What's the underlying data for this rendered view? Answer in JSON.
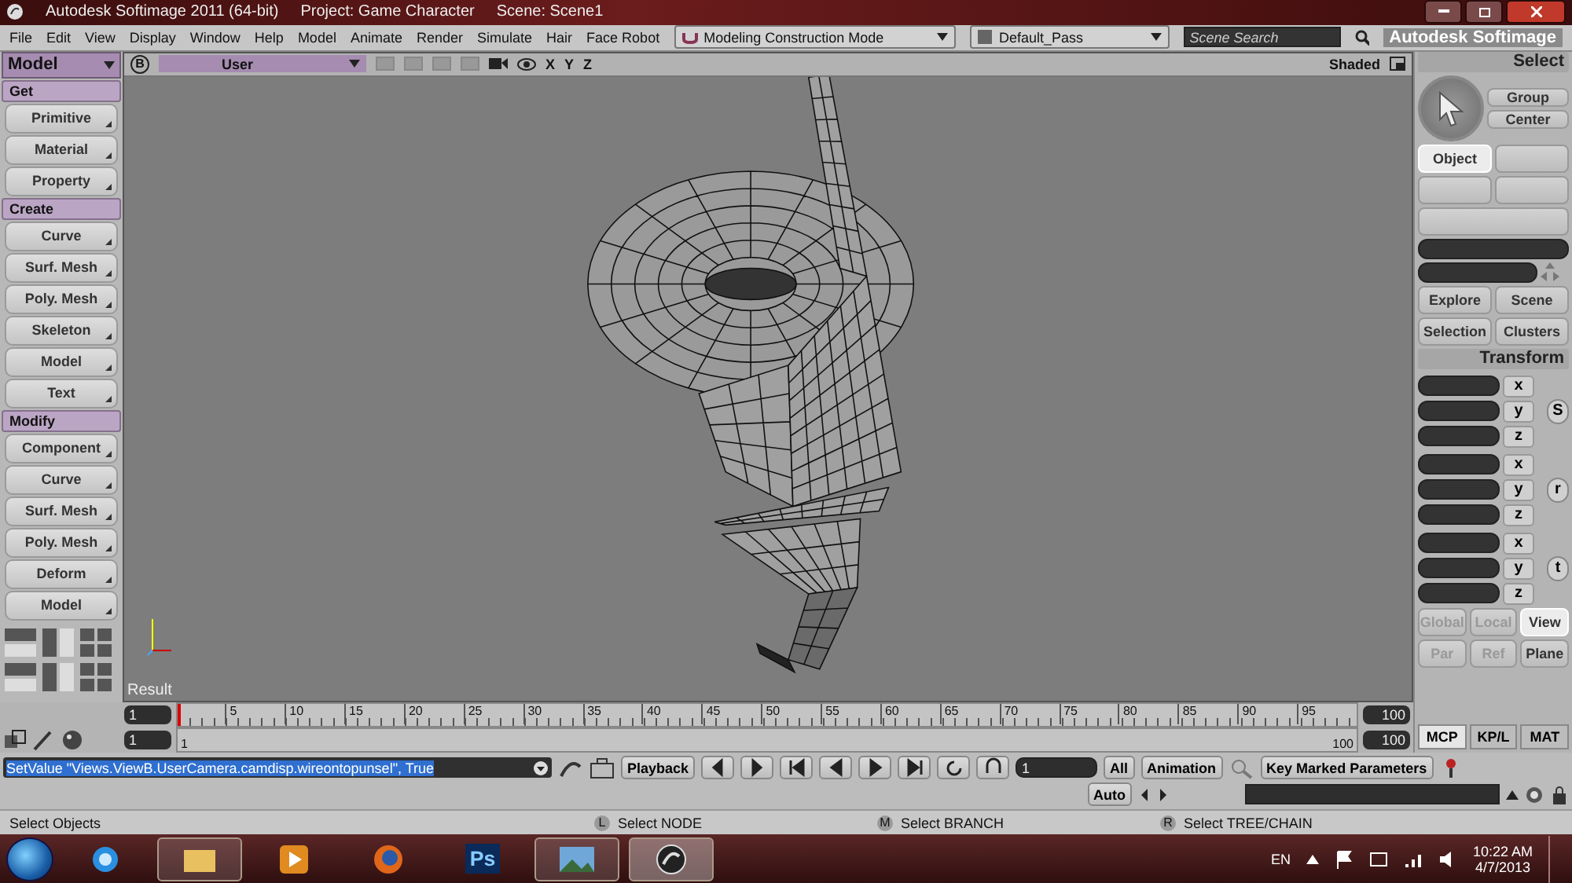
{
  "window": {
    "title": "Autodesk Softimage 2011 (64-bit)",
    "project": "Project: Game Character",
    "scene": "Scene: Scene1"
  },
  "menu": [
    "File",
    "Edit",
    "View",
    "Display",
    "Window",
    "Help",
    "Model",
    "Animate",
    "Render",
    "Simulate",
    "Hair",
    "Face Robot"
  ],
  "toolbar": {
    "mode": "Modeling Construction Mode",
    "pass": "Default_Pass",
    "search": {
      "placeholder": "Scene Search"
    },
    "brand": "Autodesk Softimage"
  },
  "left_panel": {
    "title": "Model",
    "sections": [
      {
        "title": "Get",
        "buttons": [
          "Primitive",
          "Material",
          "Property"
        ]
      },
      {
        "title": "Create",
        "buttons": [
          "Curve",
          "Surf. Mesh",
          "Poly. Mesh",
          "Skeleton",
          "Model",
          "Text"
        ]
      },
      {
        "title": "Modify",
        "buttons": [
          "Component",
          "Curve",
          "Surf. Mesh",
          "Poly. Mesh",
          "Deform",
          "Model"
        ]
      }
    ]
  },
  "viewport": {
    "letter": "B",
    "camera": "User",
    "axes": [
      "X",
      "Y",
      "Z"
    ],
    "shading": "Shaded",
    "label": "Result"
  },
  "right_panel": {
    "select": {
      "title": "Select",
      "buttons": [
        "Group",
        "Center"
      ],
      "object": {
        "label": "Object",
        "selected": true
      },
      "nav": [
        "Explore",
        "Scene",
        "Selection",
        "Clusters"
      ]
    },
    "transform": {
      "title": "Transform",
      "groups": [
        {
          "key": "S",
          "axes": [
            "x",
            "y",
            "z"
          ]
        },
        {
          "key": "r",
          "axes": [
            "x",
            "y",
            "z"
          ]
        },
        {
          "key": "t",
          "axes": [
            "x",
            "y",
            "z"
          ]
        }
      ],
      "spaces": [
        {
          "label": "Global",
          "selected": false,
          "disabled": true
        },
        {
          "label": "Local",
          "selected": false,
          "disabled": true
        },
        {
          "label": "View",
          "selected": true,
          "disabled": false
        }
      ],
      "refs": [
        {
          "label": "Par",
          "selected": false,
          "disabled": true
        },
        {
          "label": "Ref",
          "selected": false,
          "disabled": true
        },
        {
          "label": "Plane",
          "selected": false,
          "disabled": false
        }
      ]
    },
    "tabs": [
      {
        "label": "MCP",
        "selected": true
      },
      {
        "label": "KP/L",
        "selected": false
      },
      {
        "label": "MAT",
        "selected": false
      }
    ]
  },
  "timeline": {
    "start": "1",
    "end": "100",
    "ticks": [
      "5",
      "10",
      "15",
      "20",
      "25",
      "30",
      "35",
      "40",
      "45",
      "50",
      "55",
      "60",
      "65",
      "70",
      "75",
      "80",
      "85",
      "90",
      "95"
    ],
    "range_start": "1",
    "range_end": "100",
    "range_label_start": "1",
    "range_label_end": "100"
  },
  "command": {
    "text": "SetValue \"Views.ViewB.UserCamera.camdisp.wireontopunsel\", True",
    "selected": true
  },
  "playback": {
    "label": "Playback",
    "frame": "1",
    "all": "All",
    "animation": "Animation",
    "auto": "Auto",
    "key_marked": "Key Marked Parameters"
  },
  "status": {
    "message": "Select Objects",
    "hints": [
      {
        "key": "L",
        "text": "Select NODE"
      },
      {
        "key": "M",
        "text": "Select BRANCH"
      },
      {
        "key": "R",
        "text": "Select TREE/CHAIN"
      }
    ]
  },
  "taskbar": {
    "apps": [
      {
        "kind": "browser-e",
        "running": false,
        "selected": false
      },
      {
        "kind": "folder",
        "running": true,
        "selected": false
      },
      {
        "kind": "media",
        "running": false,
        "selected": false
      },
      {
        "kind": "fox",
        "running": false,
        "selected": false
      },
      {
        "kind": "ps",
        "label": "Ps",
        "running": false,
        "selected": false
      },
      {
        "kind": "picture",
        "running": true,
        "selected": false
      },
      {
        "kind": "softimage",
        "running": true,
        "selected": true
      }
    ],
    "language": "EN",
    "time": "10:22 AM",
    "date": "4/7/2013"
  }
}
